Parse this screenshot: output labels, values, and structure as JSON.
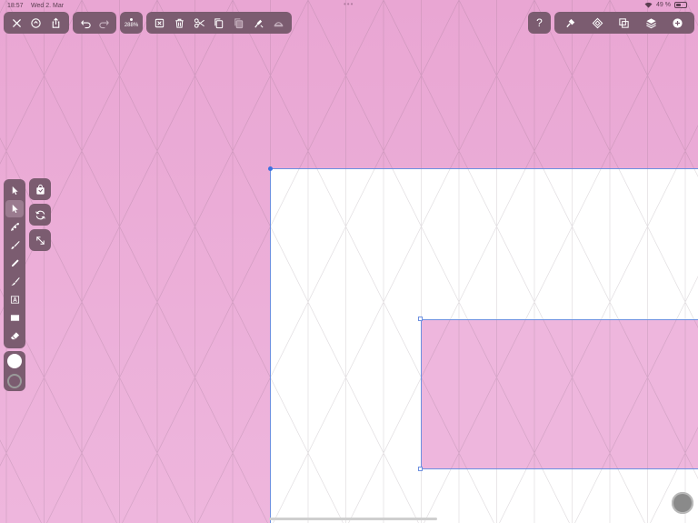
{
  "status_bar": {
    "time": "18:57",
    "date": "Wed 2. Mar",
    "battery": "49 %",
    "battery_level": 0.49
  },
  "toolbar": {
    "zoom_label": "288%",
    "help_label": "?",
    "left_group": [
      "close-icon",
      "export-icon",
      "share-icon"
    ],
    "history_group": [
      "undo-icon",
      "redo-icon"
    ],
    "edit_group": [
      "delete-selection-icon",
      "trash-icon",
      "cut-icon",
      "copy-icon",
      "paste-icon",
      "paste-style-icon",
      "clear-icon"
    ],
    "right_group": [
      "style-brush-icon",
      "symbols-icon",
      "path-ops-icon",
      "layers-icon",
      "add-icon"
    ]
  },
  "tools": [
    "selection-tool-icon",
    "direct-selection-tool-icon",
    "pen-tool-icon",
    "brush-tool-icon",
    "pencil-tool-icon",
    "paintbrush-tool-icon",
    "text-tool-icon",
    "rectangle-tool-icon",
    "eraser-tool-icon"
  ],
  "colors": {
    "toolbar_bg": "#7b5c70",
    "canvas_bg": "#e9a6d3",
    "artboard_bg": "#ffffff",
    "shape_fill": "#eeb6dd",
    "selection": "#6d8fe0",
    "fill_swatch": "#ffffff",
    "stroke_swatch": "#9a9a9a"
  }
}
